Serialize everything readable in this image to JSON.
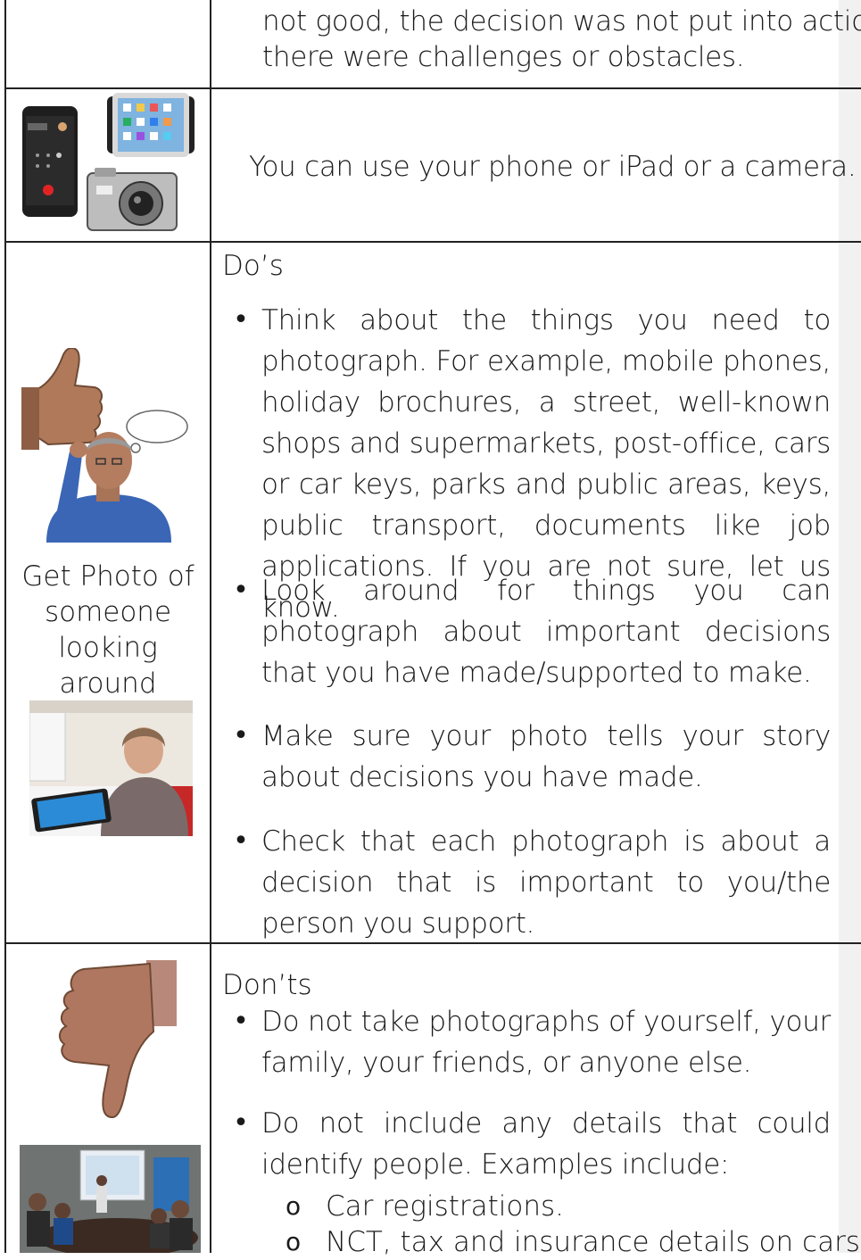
{
  "row1": {
    "lines": [
      "not good, the decision was not put into action,",
      "there were challenges or obstacles."
    ]
  },
  "row2": {
    "text": "You can use your phone or iPad or a camera.",
    "icons": [
      "smartphone-icon",
      "ipad-icon",
      "camera-icon"
    ]
  },
  "row3": {
    "heading": "Do’s",
    "caption": "Get Photo of someone looking around",
    "bullets": [
      "Think about the things you need to photograph. For example, mobile phones, holiday brochures, a street, well-known shops and supermarkets, post-office, cars or car keys, parks and public areas, keys, public transport, documents like job applications. If you are not sure, let us know.",
      "Look around for things you can photograph about important decisions that you have made/supported to make.",
      "Make sure your photo tells your story about decisions you have made.",
      "Check that each photograph is about a decision that is important to you/the person you support."
    ],
    "icons": [
      "thumbs-up-icon",
      "thinking-man-icon",
      "woman-with-tablet-photo"
    ]
  },
  "row4": {
    "heading": "Don’ts",
    "bullets": [
      "Do not take photographs of yourself, your family, your friends, or anyone else.",
      "Do not include any details that could identify people.  Examples include:"
    ],
    "subitems": [
      "Car registrations.",
      "NCT, tax and insurance details on cars."
    ],
    "icons": [
      "thumbs-down-icon",
      "meeting-room-photo"
    ]
  },
  "bullet_glyph": "•",
  "sub_glyph": "o"
}
